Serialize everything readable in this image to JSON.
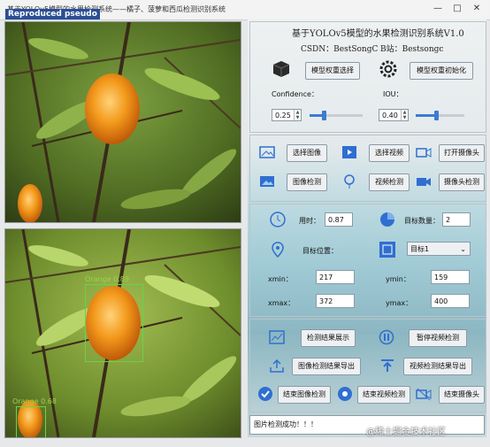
{
  "window": {
    "title": "基于YOLOv5模型的水果检测系统——橘子、菠萝和西瓜检测识别系统",
    "watermark_tl": "Reproduced pseudo",
    "min": "—",
    "max": "□",
    "close": "✕"
  },
  "header": {
    "title": "基于YOLOv5模型的水果检测识别系统V1.0",
    "csdn": "CSDN：BestSongC",
    "bilibili": "B站：Bestsongc"
  },
  "model": {
    "select_btn": "模型权重选择",
    "init_btn": "模型权重初始化",
    "confidence_label": "Confidence：",
    "confidence_value": "0.25",
    "confidence_level": 0.25,
    "iou_label": "IOU：",
    "iou_value": "0.40",
    "iou_level": 0.4
  },
  "actions": {
    "select_image": "选择图像",
    "select_video": "选择视频",
    "open_camera": "打开摄像头",
    "image_detect": "图像检测",
    "video_detect": "视频检测",
    "camera_detect": "摄像头检测"
  },
  "stats": {
    "time_label": "用时：",
    "time_value": "0.87",
    "count_label": "目标数量：",
    "count_value": "2",
    "pos_label": "目标位置：",
    "target_select": "目标1",
    "xmin_label": "xmin：",
    "xmin_value": "217",
    "ymin_label": "ymin：",
    "ymin_value": "159",
    "xmax_label": "xmax：",
    "xmax_value": "372",
    "ymax_label": "ymax：",
    "ymax_value": "400"
  },
  "bottom": {
    "show_results": "检测结果展示",
    "pause_video": "暂停视频检测",
    "export_image": "图像检测结果导出",
    "export_video": "视频检测结果导出",
    "end_image": "结束图像检测",
    "end_video": "结束视频检测",
    "end_camera": "结束摄像头"
  },
  "status_text": "图片检测成功！！！",
  "detections": [
    {
      "label": "Orange 0.89"
    },
    {
      "label": "Orange 0.68"
    }
  ],
  "watermark_br": "@稀土掘金技术社区",
  "colors": {
    "accent": "#3c7bd4",
    "orange": "#f28a12",
    "box": "#6bd24a"
  }
}
